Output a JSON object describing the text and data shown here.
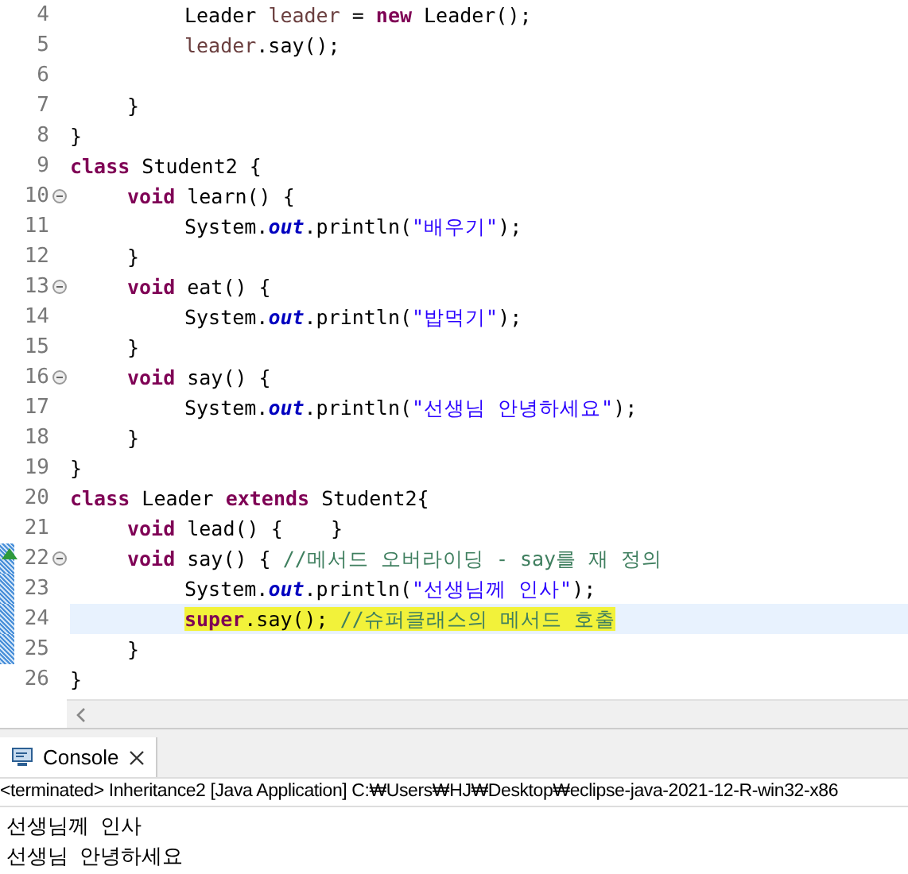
{
  "editor": {
    "lines": [
      {
        "number": "4",
        "tokens": [
          {
            "kind": "plain",
            "text": "\t\tLeader "
          },
          {
            "kind": "var",
            "text": "leader"
          },
          {
            "kind": "plain",
            "text": " = "
          },
          {
            "kind": "keyword",
            "text": "new"
          },
          {
            "kind": "plain",
            "text": " Leader();"
          }
        ]
      },
      {
        "number": "5",
        "tokens": [
          {
            "kind": "var",
            "text": "\t\tleader"
          },
          {
            "kind": "plain",
            "text": ".say();"
          }
        ]
      },
      {
        "number": "6"
      },
      {
        "number": "7",
        "tokens": [
          {
            "kind": "plain",
            "text": "\t}"
          }
        ]
      },
      {
        "number": "8",
        "tokens": [
          {
            "kind": "plain",
            "text": "}"
          }
        ]
      },
      {
        "number": "9",
        "tokens": [
          {
            "kind": "keyword",
            "text": "class"
          },
          {
            "kind": "plain",
            "text": " Student2 {"
          }
        ]
      },
      {
        "number": "10",
        "fold": true,
        "tokens": [
          {
            "kind": "keyword",
            "text": "\tvoid"
          },
          {
            "kind": "plain",
            "text": " learn() {"
          }
        ]
      },
      {
        "number": "11",
        "tokens": [
          {
            "kind": "plain",
            "text": "\t\tSystem."
          },
          {
            "kind": "field",
            "text": "out"
          },
          {
            "kind": "plain",
            "text": ".println("
          },
          {
            "kind": "string",
            "text": "\"배우기\""
          },
          {
            "kind": "plain",
            "text": ");"
          }
        ]
      },
      {
        "number": "12",
        "tokens": [
          {
            "kind": "plain",
            "text": "\t}"
          }
        ]
      },
      {
        "number": "13",
        "fold": true,
        "tokens": [
          {
            "kind": "keyword",
            "text": "\tvoid"
          },
          {
            "kind": "plain",
            "text": " eat() {"
          }
        ]
      },
      {
        "number": "14",
        "tokens": [
          {
            "kind": "plain",
            "text": "\t\tSystem."
          },
          {
            "kind": "field",
            "text": "out"
          },
          {
            "kind": "plain",
            "text": ".println("
          },
          {
            "kind": "string",
            "text": "\"밥먹기\""
          },
          {
            "kind": "plain",
            "text": ");"
          }
        ]
      },
      {
        "number": "15",
        "tokens": [
          {
            "kind": "plain",
            "text": "\t}"
          }
        ]
      },
      {
        "number": "16",
        "fold": true,
        "tokens": [
          {
            "kind": "keyword",
            "text": "\tvoid"
          },
          {
            "kind": "plain",
            "text": " say() {"
          }
        ]
      },
      {
        "number": "17",
        "tokens": [
          {
            "kind": "plain",
            "text": "\t\tSystem."
          },
          {
            "kind": "field",
            "text": "out"
          },
          {
            "kind": "plain",
            "text": ".println("
          },
          {
            "kind": "string",
            "text": "\"선생님 안녕하세요\""
          },
          {
            "kind": "plain",
            "text": ");"
          }
        ]
      },
      {
        "number": "18",
        "tokens": [
          {
            "kind": "plain",
            "text": "\t}"
          }
        ]
      },
      {
        "number": "19",
        "tokens": [
          {
            "kind": "plain",
            "text": "}"
          }
        ]
      },
      {
        "number": "20",
        "tokens": [
          {
            "kind": "keyword",
            "text": "class"
          },
          {
            "kind": "plain",
            "text": " Leader "
          },
          {
            "kind": "keyword",
            "text": "extends"
          },
          {
            "kind": "plain",
            "text": " Student2{"
          }
        ]
      },
      {
        "number": "21",
        "tokens": [
          {
            "kind": "keyword",
            "text": "\tvoid"
          },
          {
            "kind": "plain",
            "text": " lead() {    }"
          }
        ]
      },
      {
        "number": "22",
        "fold": true,
        "override": true,
        "changed": true,
        "tokens": [
          {
            "kind": "keyword",
            "text": "\tvoid"
          },
          {
            "kind": "plain",
            "text": " say() { "
          },
          {
            "kind": "comment",
            "text": "//메서드 오버라이딩 - say를 재 정의"
          }
        ]
      },
      {
        "number": "23",
        "changed": true,
        "tokens": [
          {
            "kind": "plain",
            "text": "\t\tSystem."
          },
          {
            "kind": "field",
            "text": "out"
          },
          {
            "kind": "plain",
            "text": ".println("
          },
          {
            "kind": "string",
            "text": "\"선생님께 인사\""
          },
          {
            "kind": "plain",
            "text": ");"
          }
        ]
      },
      {
        "number": "24",
        "changed": true,
        "current": true,
        "marked": true,
        "tokens": [
          {
            "kind": "keyword",
            "text": "\t\tsuper"
          },
          {
            "kind": "plain",
            "text": ".say(); "
          },
          {
            "kind": "comment",
            "text": "//슈퍼클래스의 메서드 호출"
          }
        ]
      },
      {
        "number": "25",
        "changed": true,
        "tokens": [
          {
            "kind": "plain",
            "text": "\t}"
          }
        ]
      },
      {
        "number": "26",
        "tokens": [
          {
            "kind": "plain",
            "text": "}"
          }
        ]
      }
    ]
  },
  "console": {
    "tab": {
      "label": "Console",
      "selected": true
    },
    "status": "<terminated> Inheritance2 [Java Application] C:₩Users₩HJ₩Desktop₩eclipse-java-2021-12-R-win32-x86",
    "output": [
      "선생님께  인사",
      "선생님  안녕하세요"
    ]
  }
}
